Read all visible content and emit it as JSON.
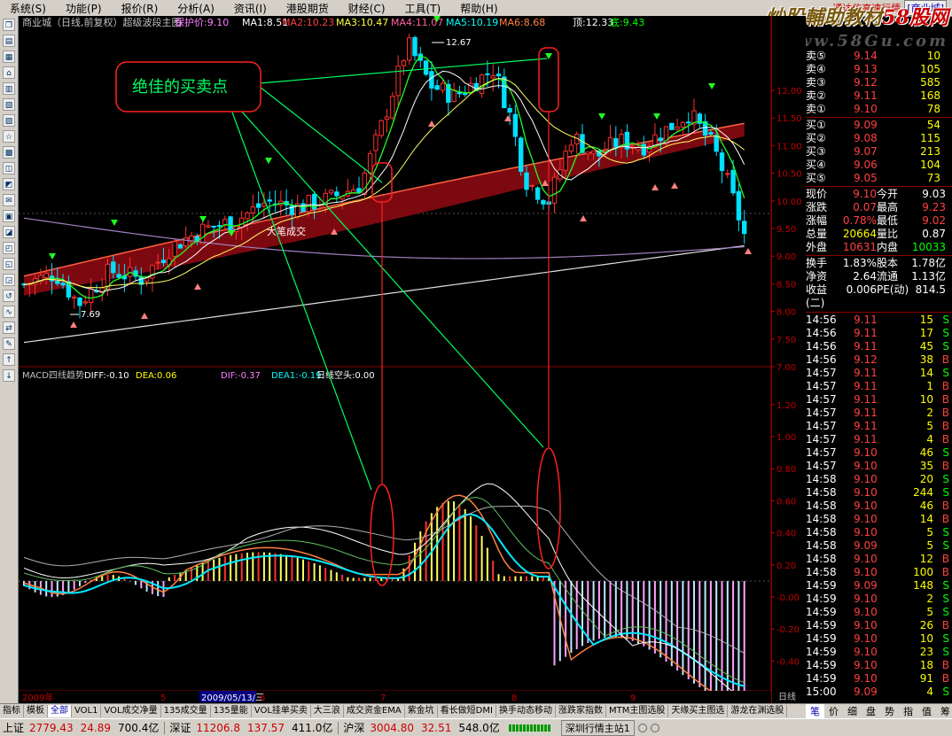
{
  "menu": {
    "items": [
      "系统(S)",
      "功能(P)",
      "报价(R)",
      "分析(A)",
      "资讯(I)",
      "港股期货",
      "财经(C)",
      "工具(T)",
      "帮助(H)"
    ],
    "broker": "通达信高速行情",
    "account": "[商业城]"
  },
  "watermark": {
    "line1a": "炒股輔助教材",
    "line1b": "58股网",
    "line2": "www.58Gu.com"
  },
  "toolbar": [
    "❐",
    "▤",
    "▦",
    "⌂",
    "▥",
    "▧",
    "▨",
    "☆",
    "▩",
    "◫",
    "◩",
    "✉",
    "▣",
    "◪",
    "◰",
    "◱",
    "◲",
    "↺",
    "∿",
    "⇄",
    "✎",
    "↑",
    "↓"
  ],
  "chart": {
    "header": "商业城（日线,前复权）超级波段主图",
    "ma_line": {
      "protect": "保护价:9.10",
      "ma1": "MA1:8.51",
      "ma2": "MA2:10.23",
      "ma3": "MA3:10.47",
      "ma4": "MA4:11.07",
      "ma5": "MA5:10.19",
      "ma6": "MA6:8.68",
      "top": "顶:12.33",
      "bottom": "底:9.43"
    },
    "annotation": "绝佳的买卖点",
    "price_labels": {
      "high": "12.67",
      "low": "7.69",
      "big": "大笔成交"
    },
    "y_ticks": [
      "12.00",
      "11.50",
      "11.00",
      "10.50",
      "10.00",
      "9.50",
      "9.00",
      "8.50",
      "8.00",
      "7.50",
      "7.00"
    ],
    "macd_header": {
      "name": "MACD四线趋势",
      "diff": "DIFF:-0.10",
      "dea": "DEA:0.06",
      "dif2": "DIF:-0.37",
      "dea1": "DEA1:-0.19",
      "trend": "日线空头:0.00"
    },
    "macd_ticks": [
      "1.20",
      "1.00",
      "0.80",
      "0.60",
      "0.40",
      "0.20",
      "-0.00",
      "-0.20",
      "-0.40"
    ],
    "x_labels": [
      "2009年",
      "5",
      "2009/05/13/三",
      "6",
      "7",
      "8",
      "9"
    ],
    "period": "日线"
  },
  "orderbook": {
    "asks": [
      {
        "label": "卖⑤",
        "price": "9.14",
        "vol": "10"
      },
      {
        "label": "卖④",
        "price": "9.13",
        "vol": "105"
      },
      {
        "label": "卖③",
        "price": "9.12",
        "vol": "585"
      },
      {
        "label": "卖②",
        "price": "9.11",
        "vol": "168"
      },
      {
        "label": "卖①",
        "price": "9.10",
        "vol": "78"
      }
    ],
    "bids": [
      {
        "label": "买①",
        "price": "9.09",
        "vol": "54"
      },
      {
        "label": "买②",
        "price": "9.08",
        "vol": "115"
      },
      {
        "label": "买③",
        "price": "9.07",
        "vol": "213"
      },
      {
        "label": "买④",
        "price": "9.06",
        "vol": "104"
      },
      {
        "label": "买⑤",
        "price": "9.05",
        "vol": "73"
      }
    ]
  },
  "quote": [
    {
      "l1": "现价",
      "v1": "9.10",
      "c1": "#ff4040",
      "l2": "今开",
      "v2": "9.03",
      "c2": "#ffffff"
    },
    {
      "l1": "涨跌",
      "v1": "0.07",
      "c1": "#ff4040",
      "l2": "最高",
      "v2": "9.23",
      "c2": "#ff4040"
    },
    {
      "l1": "涨幅",
      "v1": "0.78%",
      "c1": "#ff4040",
      "l2": "最低",
      "v2": "9.02",
      "c2": "#ff4040"
    },
    {
      "l1": "总量",
      "v1": "20664",
      "c1": "#ffff00",
      "l2": "量比",
      "v2": "0.87",
      "c2": "#ffffff"
    },
    {
      "l1": "外盘",
      "v1": "10631",
      "c1": "#ff4040",
      "l2": "内盘",
      "v2": "10033",
      "c2": "#00ff00"
    }
  ],
  "fundamentals": [
    {
      "l1": "换手",
      "v1": "1.83%",
      "l2": "股本",
      "v2": "1.78亿"
    },
    {
      "l1": "净资",
      "v1": "2.64",
      "l2": "流通",
      "v2": "1.13亿"
    },
    {
      "l1": "收益(二)",
      "v1": "0.006",
      "l2": "PE(动)",
      "v2": "814.5"
    }
  ],
  "ticks": [
    {
      "t": "14:56",
      "p": "9.11",
      "v": "15",
      "s": "S"
    },
    {
      "t": "14:56",
      "p": "9.11",
      "v": "17",
      "s": "S"
    },
    {
      "t": "14:56",
      "p": "9.11",
      "v": "45",
      "s": "S"
    },
    {
      "t": "14:56",
      "p": "9.12",
      "v": "38",
      "s": "B"
    },
    {
      "t": "14:57",
      "p": "9.11",
      "v": "14",
      "s": "S"
    },
    {
      "t": "14:57",
      "p": "9.11",
      "v": "1",
      "s": "B"
    },
    {
      "t": "14:57",
      "p": "9.11",
      "v": "10",
      "s": "B"
    },
    {
      "t": "14:57",
      "p": "9.11",
      "v": "2",
      "s": "B"
    },
    {
      "t": "14:57",
      "p": "9.11",
      "v": "5",
      "s": "B"
    },
    {
      "t": "14:57",
      "p": "9.11",
      "v": "4",
      "s": "B"
    },
    {
      "t": "14:57",
      "p": "9.10",
      "v": "46",
      "s": "S"
    },
    {
      "t": "14:57",
      "p": "9.10",
      "v": "35",
      "s": "B"
    },
    {
      "t": "14:58",
      "p": "9.10",
      "v": "20",
      "s": "S"
    },
    {
      "t": "14:58",
      "p": "9.10",
      "v": "244",
      "s": "S"
    },
    {
      "t": "14:58",
      "p": "9.10",
      "v": "46",
      "s": "B"
    },
    {
      "t": "14:58",
      "p": "9.10",
      "v": "14",
      "s": "B"
    },
    {
      "t": "14:58",
      "p": "9.10",
      "v": "5",
      "s": "S"
    },
    {
      "t": "14:58",
      "p": "9.09",
      "v": "5",
      "s": "S"
    },
    {
      "t": "14:58",
      "p": "9.10",
      "v": "12",
      "s": "B"
    },
    {
      "t": "14:58",
      "p": "9.10",
      "v": "100",
      "s": "B"
    },
    {
      "t": "14:59",
      "p": "9.09",
      "v": "148",
      "s": "S"
    },
    {
      "t": "14:59",
      "p": "9.10",
      "v": "2",
      "s": "S"
    },
    {
      "t": "14:59",
      "p": "9.10",
      "v": "5",
      "s": "S"
    },
    {
      "t": "14:59",
      "p": "9.10",
      "v": "26",
      "s": "B"
    },
    {
      "t": "14:59",
      "p": "9.10",
      "v": "10",
      "s": "S"
    },
    {
      "t": "14:59",
      "p": "9.10",
      "v": "23",
      "s": "S"
    },
    {
      "t": "14:59",
      "p": "9.10",
      "v": "18",
      "s": "B"
    },
    {
      "t": "14:59",
      "p": "9.10",
      "v": "91",
      "s": "B"
    },
    {
      "t": "15:00",
      "p": "9.09",
      "v": "4",
      "s": "S"
    }
  ],
  "bottom_tabs": [
    "指标",
    "模板",
    "全部",
    "VOL1",
    "VOL成交净量",
    "135成交量",
    "135量能",
    "VOL挂单买卖",
    "大三浪",
    "成交资金EMA",
    "紫金坑",
    "看长做短DMI",
    "换手动态移动",
    "涨跌家指数",
    "MTM主图选股",
    "天缘买主图选",
    "游龙在渊选股"
  ],
  "right_tabs": [
    "笔",
    "价",
    "细",
    "盘",
    "势",
    "指",
    "值",
    "筹"
  ],
  "status": {
    "sh_label": "上证",
    "sh_index": "2779.43",
    "sh_change": "24.89",
    "sh_amount": "700.4亿",
    "sz_label": "深证",
    "sz_index": "11206.8",
    "sz_change": "137.57",
    "sz_amount": "411.0亿",
    "hs_label": "沪深",
    "hs_index": "3004.80",
    "hs_change": "32.51",
    "hs_amount": "548.0亿",
    "site": "深圳行情主站1"
  },
  "colors": {
    "up": "#ff3030",
    "down": "#00e0ff",
    "ma_white": "#ffffff",
    "ma_green": "#20ff20",
    "ribbon": "#8b0a12",
    "annot": "#00ff60",
    "macd_pos": "#ffff60",
    "macd_neg": "#ffa0ff"
  }
}
